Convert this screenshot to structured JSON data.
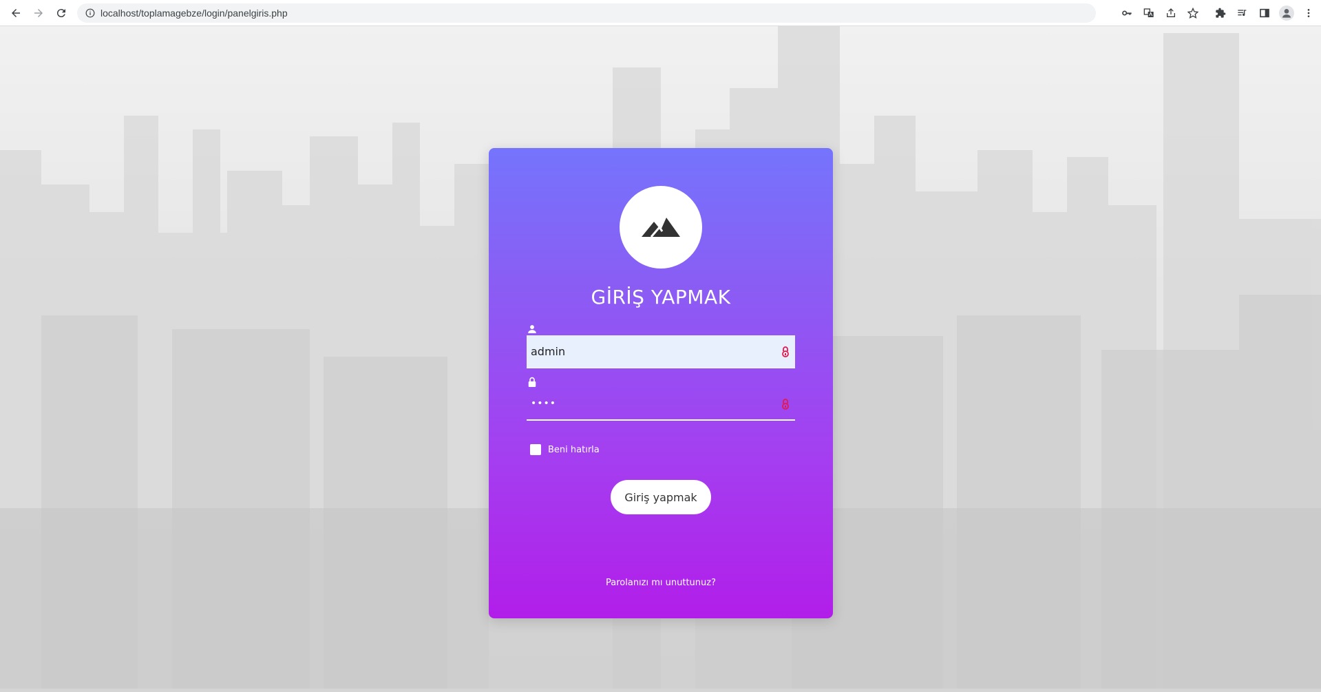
{
  "browser": {
    "url": "localhost/toplamagebze/login/panelgiris.php",
    "icons": [
      "back-icon",
      "forward-icon",
      "reload-icon",
      "site-info-icon",
      "key-icon",
      "translate-icon",
      "share-icon",
      "star-icon",
      "extensions-icon",
      "reading-list-icon",
      "side-panel-icon",
      "profile-icon",
      "menu-icon"
    ]
  },
  "login": {
    "title": "GİRİŞ YAPMAK",
    "username_value": "admin",
    "password_mask": "••••",
    "remember_label": "Beni hatırla",
    "submit_label": "Giriş yapmak",
    "forgot_label": "Parolanızı mı unuttunuz?"
  },
  "colors": {
    "card_gradient_top": "#7574fd",
    "card_gradient_bottom": "#b11ee9",
    "autofill_bg": "#e8f0fe",
    "password_manager_key": "#e8174a"
  }
}
